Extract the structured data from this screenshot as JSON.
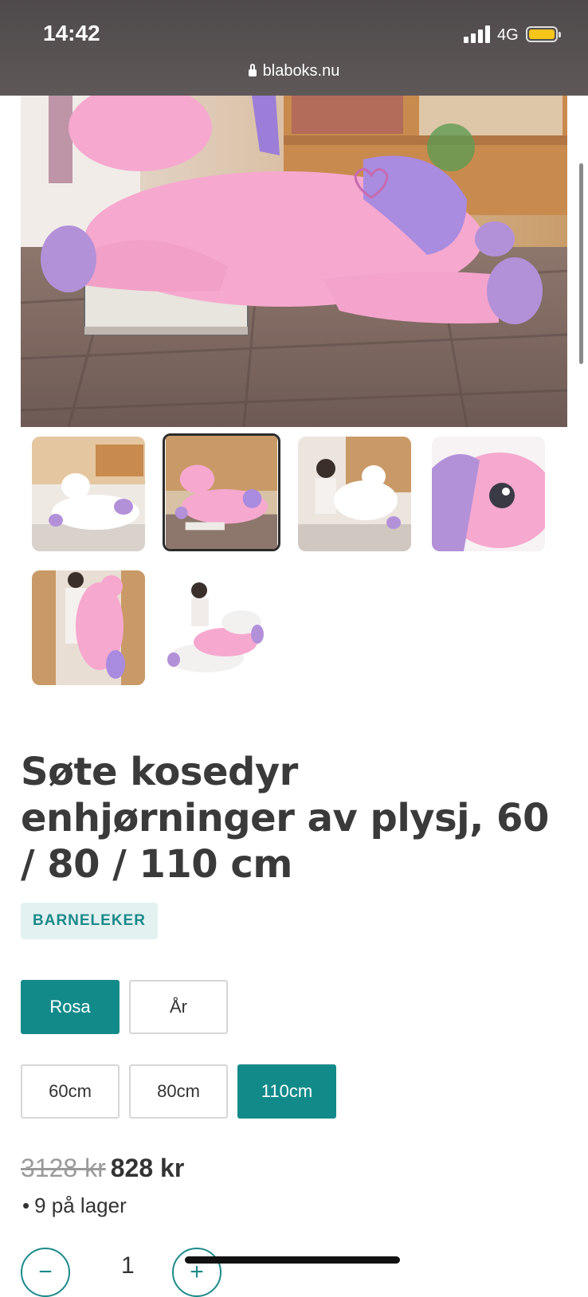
{
  "status_bar": {
    "time": "14:42",
    "network": "4G",
    "url": "blaboks.nu",
    "icons": [
      "signal-icon",
      "battery-icon",
      "lock-icon"
    ]
  },
  "gallery": {
    "main_image": "pink unicorn plush lying on floor",
    "thumbnails": [
      {
        "name": "white unicorn plush",
        "selected": false
      },
      {
        "name": "pink unicorn plush",
        "selected": true
      },
      {
        "name": "girl with white unicorn plush",
        "selected": false
      },
      {
        "name": "pink unicorn face closeup",
        "selected": false
      },
      {
        "name": "girl holding pink unicorn",
        "selected": false
      },
      {
        "name": "girl with three unicorn plushes",
        "selected": false
      }
    ]
  },
  "product": {
    "title": "Søte kosedyr enhjørninger av plysj, 60 / 80 / 110 cm",
    "category": "BARNELEKER",
    "colors": [
      {
        "label": "Rosa",
        "selected": true
      },
      {
        "label": "År",
        "selected": false
      }
    ],
    "sizes": [
      {
        "label": "60cm",
        "selected": false
      },
      {
        "label": "80cm",
        "selected": false
      },
      {
        "label": "110cm",
        "selected": true
      }
    ],
    "old_price": "3128 kr",
    "price": "828 kr",
    "stock_bullet": "•",
    "stock": "9 på lager",
    "quantity": "1",
    "minus_label": "−",
    "plus_label": "+"
  },
  "colors": {
    "accent": "#138a8a",
    "category_bg": "#e3f1f1",
    "unicorn_pink": "#f6a8cf",
    "unicorn_purple": "#a98be0"
  }
}
